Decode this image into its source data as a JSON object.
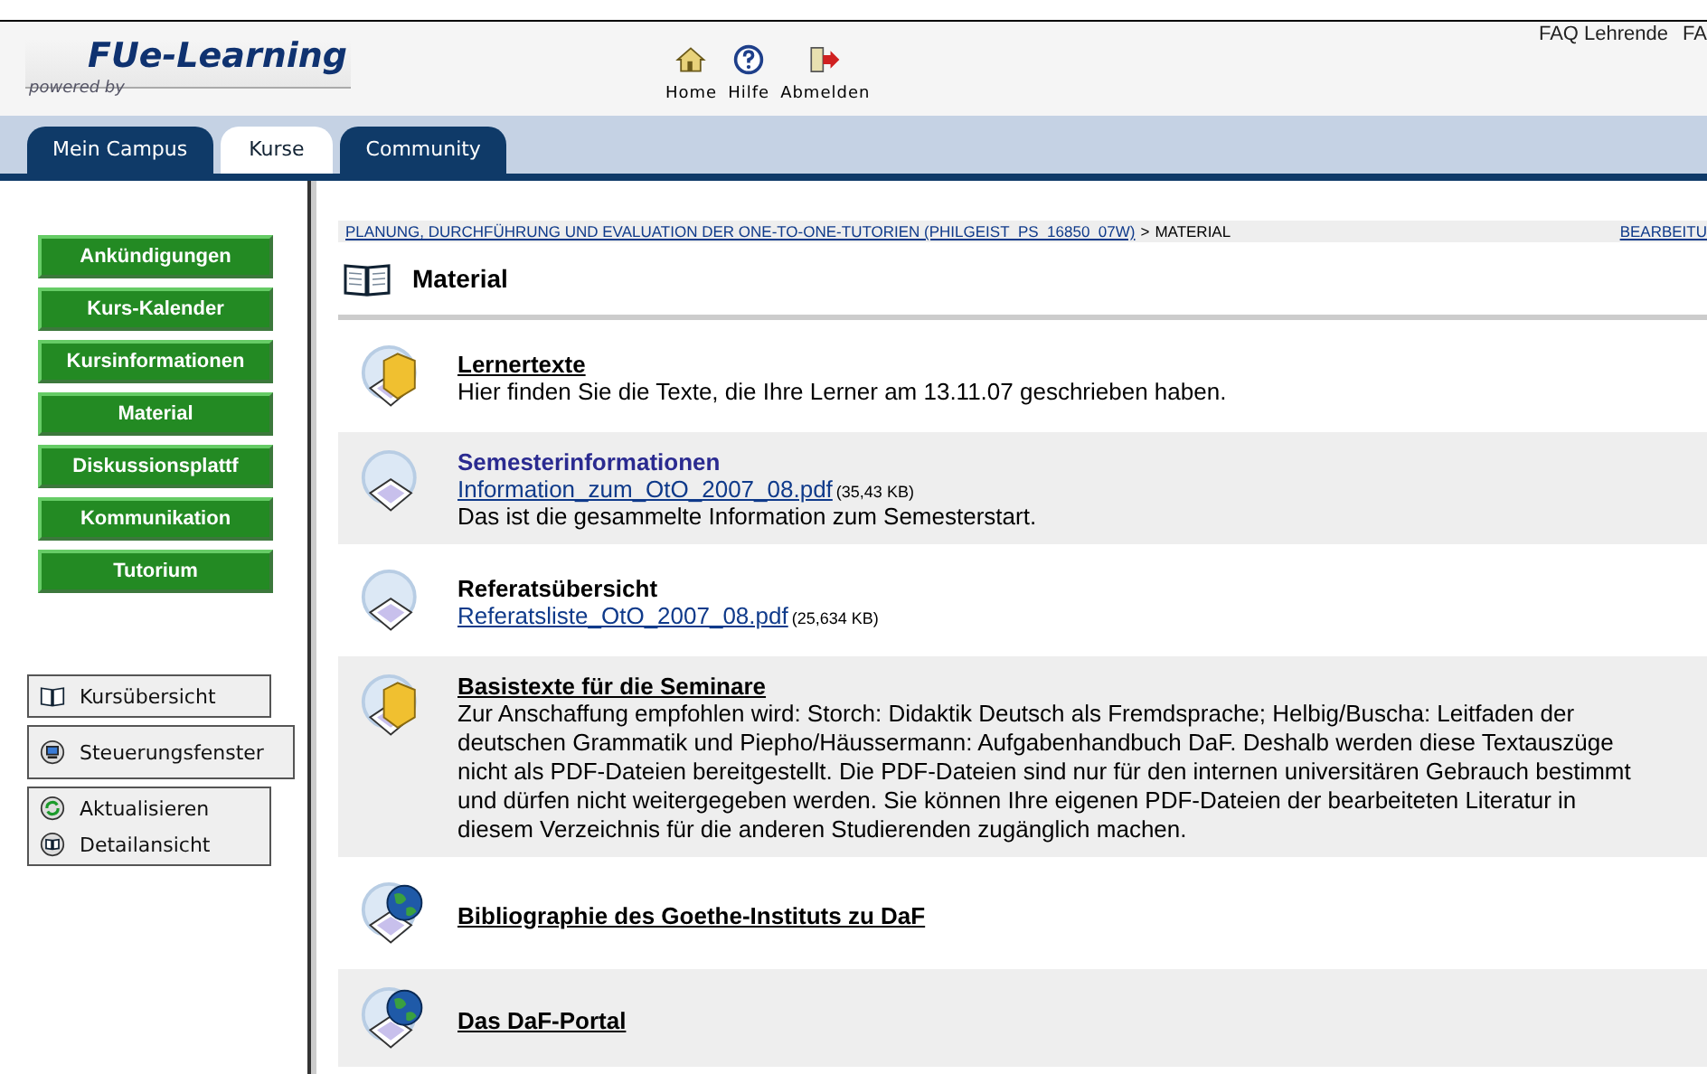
{
  "header": {
    "logo_brand": "FUe-Learning",
    "logo_sub": "powered by",
    "top_links": [
      "FAQ Lehrende",
      "FA"
    ],
    "tools": [
      {
        "kind": "home",
        "label": "Home"
      },
      {
        "kind": "help",
        "label": "Hilfe"
      },
      {
        "kind": "logout",
        "label": "Abmelden"
      }
    ]
  },
  "tabs": [
    {
      "label": "Mein Campus",
      "selected": false
    },
    {
      "label": "Kurse",
      "selected": true
    },
    {
      "label": "Community",
      "selected": false
    }
  ],
  "course_menu": [
    {
      "label": "Ankündigungen"
    },
    {
      "label": "Kurs-Kalender"
    },
    {
      "label": "Kursinformationen"
    },
    {
      "label": "Material"
    },
    {
      "label": "Diskussionsplattf"
    },
    {
      "label": "Kommunikation"
    },
    {
      "label": "Tutorium"
    }
  ],
  "side_panels": [
    [
      {
        "kind": "book",
        "label": "Kursübersicht"
      }
    ],
    [
      {
        "kind": "monitor",
        "label": "Steuerungsfenster"
      }
    ],
    [
      {
        "kind": "refresh",
        "label": "Aktualisieren"
      },
      {
        "kind": "detail",
        "label": "Detailansicht"
      }
    ]
  ],
  "breadcrumb": {
    "path_link": "PLANUNG, DURCHFÜHRUNG UND EVALUATION DER ONE-TO-ONE-TUTORIEN (PHILGEIST_PS_16850_07W)",
    "separator": ">",
    "current": "MATERIAL",
    "right_link": "BEARBEITU"
  },
  "page_title": "Material",
  "items": [
    {
      "kind": "folder",
      "title": "Lernertexte",
      "underlined": true,
      "highlighted": false,
      "description": "Hier finden Sie die Texte, die Ihre Lerner am 13.11.07 geschrieben haben."
    },
    {
      "kind": "file",
      "title": "Semesterinformationen",
      "underlined": false,
      "highlighted": true,
      "file": "Information_zum_OtO_2007_08.pdf",
      "size": "(35,43 KB)",
      "description": "Das ist die gesammelte Information zum Semesterstart."
    },
    {
      "kind": "file",
      "title": "Referatsübersicht",
      "underlined": false,
      "highlighted": false,
      "file": "Referatsliste_OtO_2007_08.pdf",
      "size": "(25,634 KB)"
    },
    {
      "kind": "folder",
      "title": "Basistexte für die Seminare",
      "underlined": true,
      "highlighted": false,
      "description": "Zur Anschaffung empfohlen wird: Storch: Didaktik Deutsch als Fremdsprache; Helbig/Buscha: Leitfaden der deutschen Grammatik und Piepho/Häussermann: Aufgabenhandbuch DaF. Deshalb werden diese Textauszüge nicht als PDF-Dateien bereitgestellt. Die PDF-Dateien sind nur für den internen universitären Gebrauch bestimmt und dürfen nicht weitergegeben werden. Sie können Ihre eigenen PDF-Dateien der bearbeiteten Literatur in diesem Verzeichnis für die anderen Studierenden zugänglich machen."
    },
    {
      "kind": "weblink",
      "title": "Bibliographie des Goethe-Instituts zu DaF",
      "underlined": true,
      "highlighted": false
    },
    {
      "kind": "weblink",
      "title": "Das DaF-Portal",
      "underlined": true,
      "highlighted": false
    }
  ]
}
